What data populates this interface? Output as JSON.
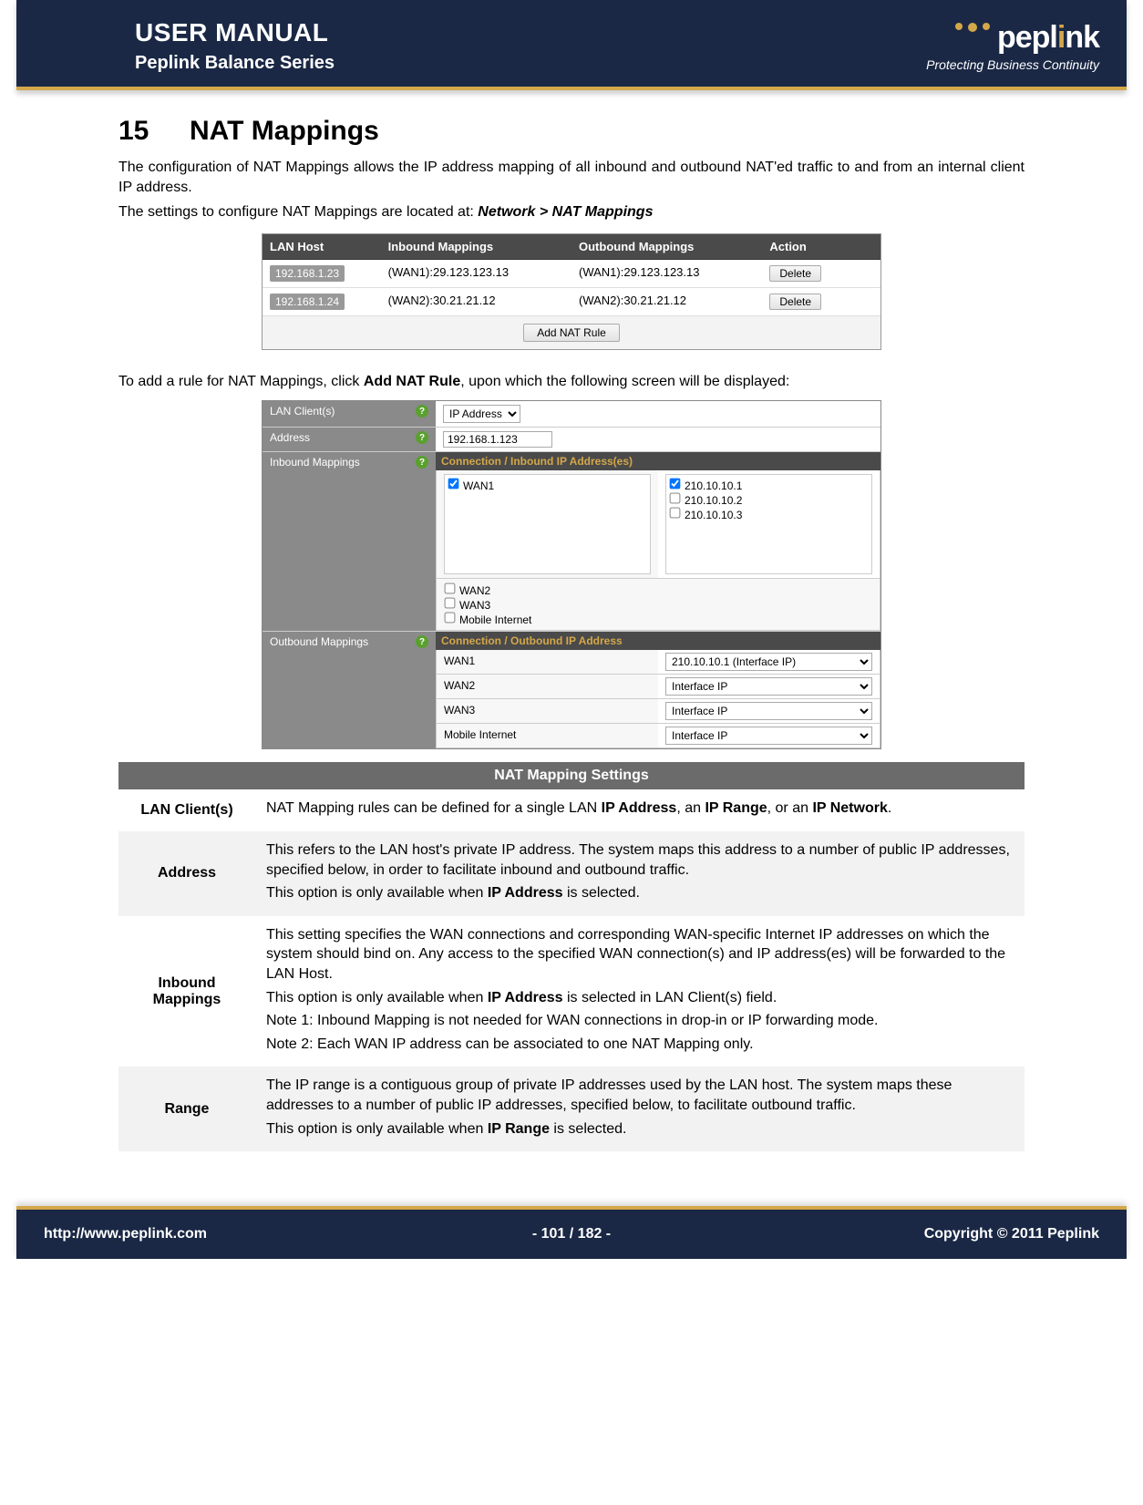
{
  "header": {
    "title": "USER MANUAL",
    "subtitle": "Peplink Balance Series",
    "brand_prefix": "pepl",
    "brand_i": "i",
    "brand_suffix": "nk",
    "tagline": "Protecting Business Continuity"
  },
  "chapter": {
    "number": "15",
    "title": "NAT Mappings"
  },
  "intro": {
    "p1": "The configuration of NAT Mappings allows the IP address mapping of all inbound and outbound NAT'ed traffic to and from an internal client IP address.",
    "p2_pre": "The settings to configure NAT Mappings are located at: ",
    "p2_bold": "Network > NAT Mappings"
  },
  "shot1": {
    "cols": {
      "c1": "LAN Host",
      "c2": "Inbound Mappings",
      "c3": "Outbound Mappings",
      "c4": "Action"
    },
    "rows": [
      {
        "host": "192.168.1.23",
        "in": "(WAN1):29.123.123.13",
        "out": "(WAN1):29.123.123.13",
        "action": "Delete"
      },
      {
        "host": "192.168.1.24",
        "in": "(WAN2):30.21.21.12",
        "out": "(WAN2):30.21.21.12",
        "action": "Delete"
      }
    ],
    "add_label": "Add NAT Rule"
  },
  "mid": {
    "pre": "To add a rule for NAT Mappings, click ",
    "bold": "Add NAT Rule",
    "post": ", upon which the following screen will be displayed:"
  },
  "shot2": {
    "labels": {
      "clients": "LAN Client(s)",
      "address": "Address",
      "inbound": "Inbound Mappings",
      "outbound": "Outbound Mappings"
    },
    "clients_select": "IP Address",
    "address_value": "192.168.1.123",
    "inbound": {
      "header": "Connection / Inbound IP Address(es)",
      "wan1": "WAN1",
      "ips": [
        "210.10.10.1",
        "210.10.10.2",
        "210.10.10.3"
      ],
      "ips_checked": [
        true,
        false,
        false
      ],
      "others": [
        "WAN2",
        "WAN3",
        "Mobile Internet"
      ]
    },
    "outbound": {
      "header": "Connection / Outbound IP Address",
      "rows": [
        {
          "name": "WAN1",
          "sel": "210.10.10.1 (Interface IP)"
        },
        {
          "name": "WAN2",
          "sel": "Interface IP"
        },
        {
          "name": "WAN3",
          "sel": "Interface IP"
        },
        {
          "name": "Mobile Internet",
          "sel": "Interface IP"
        }
      ]
    }
  },
  "settings": {
    "title": "NAT Mapping Settings",
    "rows": {
      "lan": {
        "name": "LAN Client(s)",
        "pre": "NAT Mapping rules can be defined for a single LAN ",
        "b1": "IP Address",
        "mid1": ", an ",
        "b2": "IP Range",
        "mid2": ", or an ",
        "b3": "IP Network",
        "post": "."
      },
      "addr": {
        "name": "Address",
        "p1": "This refers to the LAN host's private IP address. The system maps this address to a number of public IP addresses, specified below, in order to facilitate inbound and outbound traffic.",
        "p2_pre": " This option is only available when ",
        "p2_b": "IP Address",
        "p2_post": " is selected."
      },
      "inb": {
        "name": "Inbound Mappings",
        "p1": "This setting specifies the WAN connections and corresponding WAN-specific Internet IP addresses on which the system should bind on.  Any access to the specified WAN connection(s) and IP address(es) will be forwarded to the LAN Host.",
        "p2_pre": "This option is only available when ",
        "p2_b": "IP Address",
        "p2_post": " is selected in LAN Client(s) field.",
        "p3": "Note 1: Inbound Mapping is not needed for WAN connections in drop-in or IP forwarding mode.",
        "p4": "Note 2: Each WAN IP address can be associated to one NAT Mapping only."
      },
      "rng": {
        "name": "Range",
        "p1": "The IP range is a contiguous group of private IP addresses used by the LAN host. The system maps these addresses to a number of public IP addresses, specified below, to facilitate outbound traffic.",
        "p2_pre": " This option is only available when ",
        "p2_b": "IP Range",
        "p2_post": " is selected."
      }
    }
  },
  "footer": {
    "url": "http://www.peplink.com",
    "page": "- 101 / 182 -",
    "copy": "Copyright © 2011 Peplink"
  }
}
